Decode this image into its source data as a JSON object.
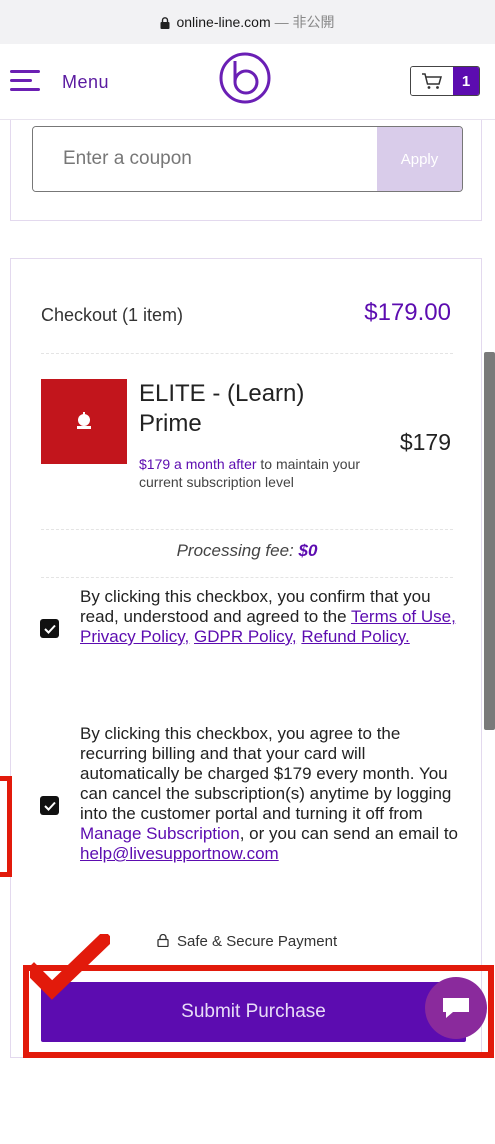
{
  "browser": {
    "url": "online-line.com",
    "url_suffix": "— 非公開"
  },
  "header": {
    "menu_label": "Menu",
    "cart_count": "1"
  },
  "coupon": {
    "placeholder": "Enter a coupon",
    "apply_label": "Apply"
  },
  "checkout": {
    "title": "Checkout (1 item)",
    "total": "$179.00",
    "product": {
      "name": "ELITE - (Learn) Prime",
      "price": "$179",
      "note_accent": "$179 a month after",
      "note_rest": " to maintain your current subscription level"
    },
    "processing_fee_label": "Processing fee:",
    "processing_fee_value": "$0",
    "agree_terms": {
      "text": "By clicking this checkbox, you confirm that you read, understood and agreed to the",
      "links": [
        "Terms of Use,",
        "Privacy Policy,",
        "GDPR Policy,",
        "Refund Policy."
      ]
    },
    "agree_billing": {
      "text": "By clicking this checkbox, you agree to the recurring billing and that your card will automatically be charged $179 every month. You can cancel the subscription(s) anytime by logging into the customer portal and turning it off from",
      "manage_link": "Manage Subscription",
      "text2": ", or you can send an email to",
      "email": "help@livesupportnow.com"
    },
    "secure_label": "Safe & Secure Payment",
    "submit_label": "Submit Purchase"
  },
  "colors": {
    "brand": "#5c0cb0",
    "annotation": "#e21a0b",
    "thumb": "#c2151c"
  }
}
